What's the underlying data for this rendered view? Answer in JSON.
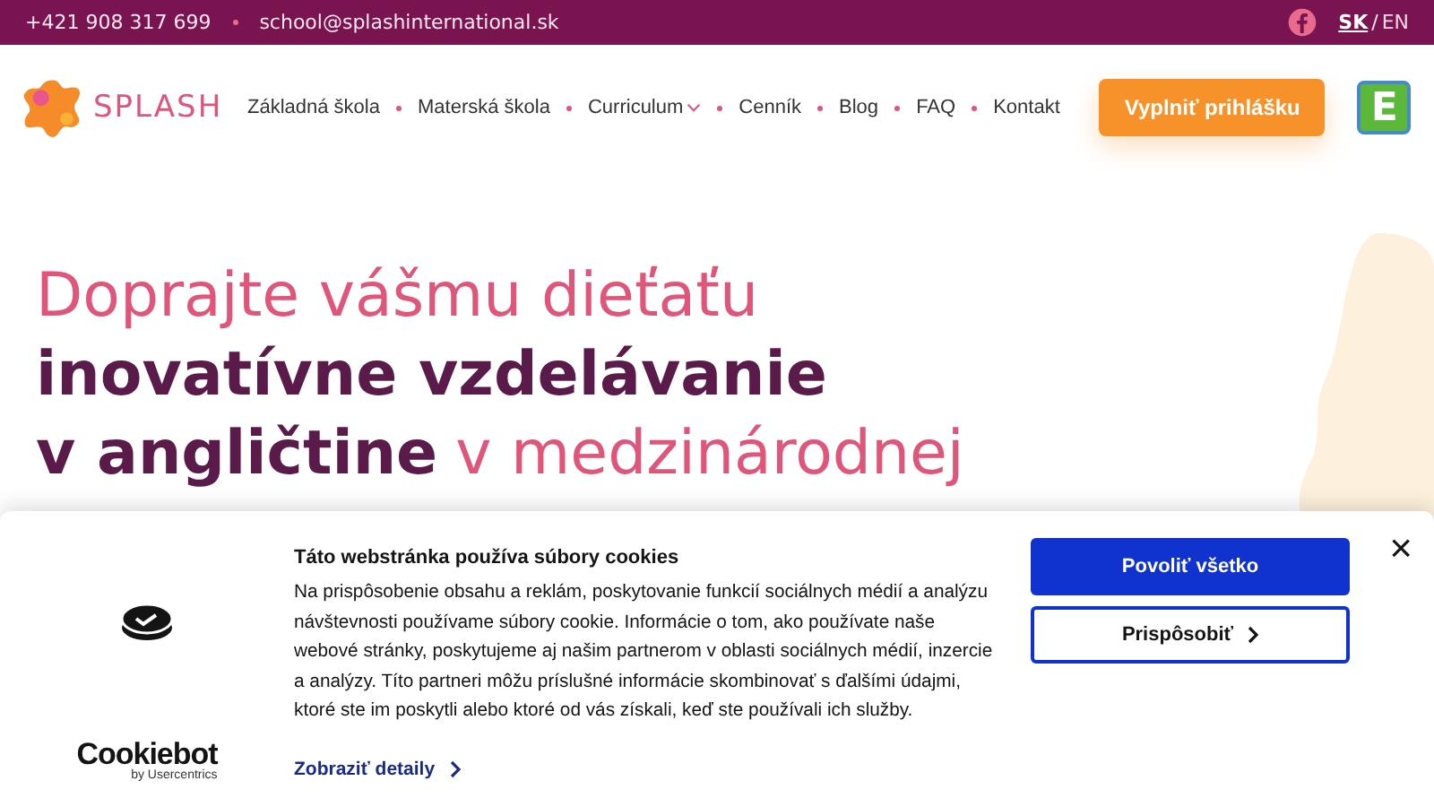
{
  "top_bar": {
    "phone": "+421 908 317 699",
    "email": "school@splashinternational.sk",
    "languages": [
      {
        "code": "SK",
        "selected": true
      },
      {
        "code": "EN",
        "selected": false
      }
    ],
    "language_separator": "/"
  },
  "header": {
    "logo": "SPLASH",
    "nav": [
      {
        "label": "Základná škola",
        "has_submenu": false
      },
      {
        "label": "Materská škola",
        "has_submenu": false
      },
      {
        "label": "Curriculum",
        "has_submenu": true
      },
      {
        "label": "Cenník",
        "has_submenu": false
      },
      {
        "label": "Blog",
        "has_submenu": false
      },
      {
        "label": "FAQ",
        "has_submenu": false
      },
      {
        "label": "Kontakt",
        "has_submenu": false
      }
    ],
    "cta": "Vyplniť prihlášku",
    "badge": "E"
  },
  "hero": {
    "headline": [
      [
        {
          "text": "Doprajte vášmu dieťaťu",
          "strong": false
        }
      ],
      [
        {
          "text": "inovatívne vzdelávanie",
          "strong": true
        }
      ],
      [
        {
          "text": "v angličtine",
          "strong": true
        },
        {
          "text": "v medzinárodnej",
          "strong": false
        }
      ]
    ]
  },
  "cookie_banner": {
    "brand": "Cookiebot",
    "brand_sub": "by Usercentrics",
    "title": "Táto webstránka používa súbory cookies",
    "body": "Na prispôsobenie obsahu a reklám, poskytovanie funkcií sociálnych médií a analýzu návštevnosti používame súbory cookie. Informácie o tom, ako používate naše webové stránky, poskytujeme aj našim partnerom v oblasti sociálnych médií, inzercie a analýzy. Títo partneri môžu príslušné informácie skombinovať s ďalšími údajmi, ktoré ste im poskytli alebo ktoré od vás získali, keď ste používali ich služby.",
    "details_link": "Zobraziť detaily",
    "buttons": [
      {
        "label": "Povoliť všetko",
        "kind": "primary"
      },
      {
        "label": "Prispôsobiť",
        "kind": "secondary"
      }
    ],
    "close": "×"
  }
}
